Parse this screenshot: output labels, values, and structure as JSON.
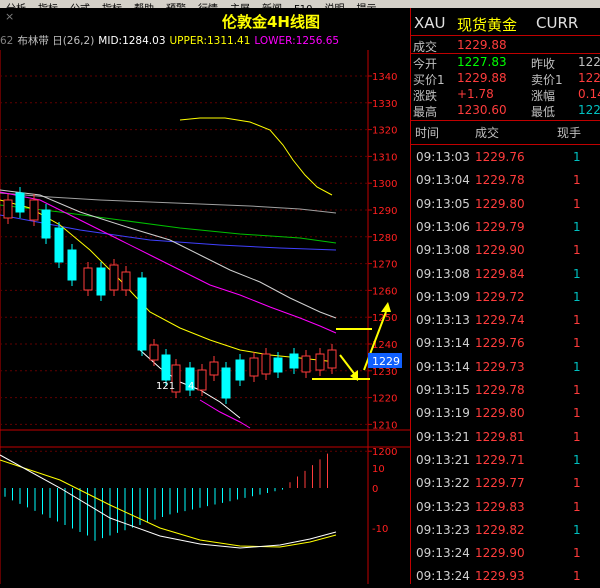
{
  "menu": [
    "分析",
    "指标",
    "公式",
    "指标",
    "帮助",
    "预警",
    "行情",
    "主屏",
    "新闻",
    "F10",
    "说明",
    "提示"
  ],
  "chart": {
    "title": "伦敦金4H线图",
    "close_label": "×",
    "indicator": {
      "prefix": "62",
      "name": "布林带 日(26,2)",
      "mid": "MID:1284.03",
      "upper": "UPPER:1311.41",
      "lower": "LOWER:1256.65"
    },
    "price_axis": [
      "1340",
      "1330",
      "1320",
      "1310",
      "1300",
      "1290",
      "1280",
      "1270",
      "1260",
      "1250",
      "1240",
      "1230",
      "1220",
      "1210",
      "1200"
    ],
    "current_price": "1229",
    "sub_axis": [
      "10",
      "0",
      "-10"
    ],
    "candle_labels": [
      "121",
      "4"
    ]
  },
  "panel": {
    "code": "XAU",
    "name": "现货黄金",
    "ticker": "CURR",
    "quote": {
      "deal_label": "成交",
      "deal_value": "1229.88",
      "open_label": "今开",
      "open_value": "1227.83",
      "prev_label": "昨收",
      "prev_value": "122",
      "bid_label": "买价1",
      "bid_value": "1229.88",
      "ask_label": "卖价1",
      "ask_value": "122",
      "change_label": "涨跌",
      "change_value": "+1.78",
      "pct_label": "涨幅",
      "pct_value": "0.14",
      "high_label": "最高",
      "high_value": "1230.60",
      "low_label": "最低",
      "low_value": "122"
    },
    "ticks_header": {
      "time": "时间",
      "price": "成交",
      "vol": "现手"
    },
    "ticks": [
      {
        "time": "09:13:03",
        "price": "1229.76",
        "vol": "1",
        "color": "#00c0c0"
      },
      {
        "time": "09:13:04",
        "price": "1229.78",
        "vol": "1",
        "color": "#ff3c3c"
      },
      {
        "time": "09:13:05",
        "price": "1229.80",
        "vol": "1",
        "color": "#ff3c3c"
      },
      {
        "time": "09:13:06",
        "price": "1229.79",
        "vol": "1",
        "color": "#00c0c0"
      },
      {
        "time": "09:13:08",
        "price": "1229.90",
        "vol": "1",
        "color": "#ff3c3c"
      },
      {
        "time": "09:13:08",
        "price": "1229.84",
        "vol": "1",
        "color": "#00c0c0"
      },
      {
        "time": "09:13:09",
        "price": "1229.72",
        "vol": "1",
        "color": "#00c0c0"
      },
      {
        "time": "09:13:13",
        "price": "1229.74",
        "vol": "1",
        "color": "#ff3c3c"
      },
      {
        "time": "09:13:14",
        "price": "1229.76",
        "vol": "1",
        "color": "#ff3c3c"
      },
      {
        "time": "09:13:14",
        "price": "1229.73",
        "vol": "1",
        "color": "#00c0c0"
      },
      {
        "time": "09:13:15",
        "price": "1229.78",
        "vol": "1",
        "color": "#ff3c3c"
      },
      {
        "time": "09:13:19",
        "price": "1229.80",
        "vol": "1",
        "color": "#ff3c3c"
      },
      {
        "time": "09:13:21",
        "price": "1229.81",
        "vol": "1",
        "color": "#ff3c3c"
      },
      {
        "time": "09:13:21",
        "price": "1229.71",
        "vol": "1",
        "color": "#00c0c0"
      },
      {
        "time": "09:13:22",
        "price": "1229.77",
        "vol": "1",
        "color": "#ff3c3c"
      },
      {
        "time": "09:13:23",
        "price": "1229.83",
        "vol": "1",
        "color": "#ff3c3c"
      },
      {
        "time": "09:13:23",
        "price": "1229.82",
        "vol": "1",
        "color": "#00c0c0"
      },
      {
        "time": "09:13:24",
        "price": "1229.90",
        "vol": "1",
        "color": "#ff3c3c"
      },
      {
        "time": "09:13:24",
        "price": "1229.93",
        "vol": "1",
        "color": "#ff3c3c"
      }
    ]
  }
}
